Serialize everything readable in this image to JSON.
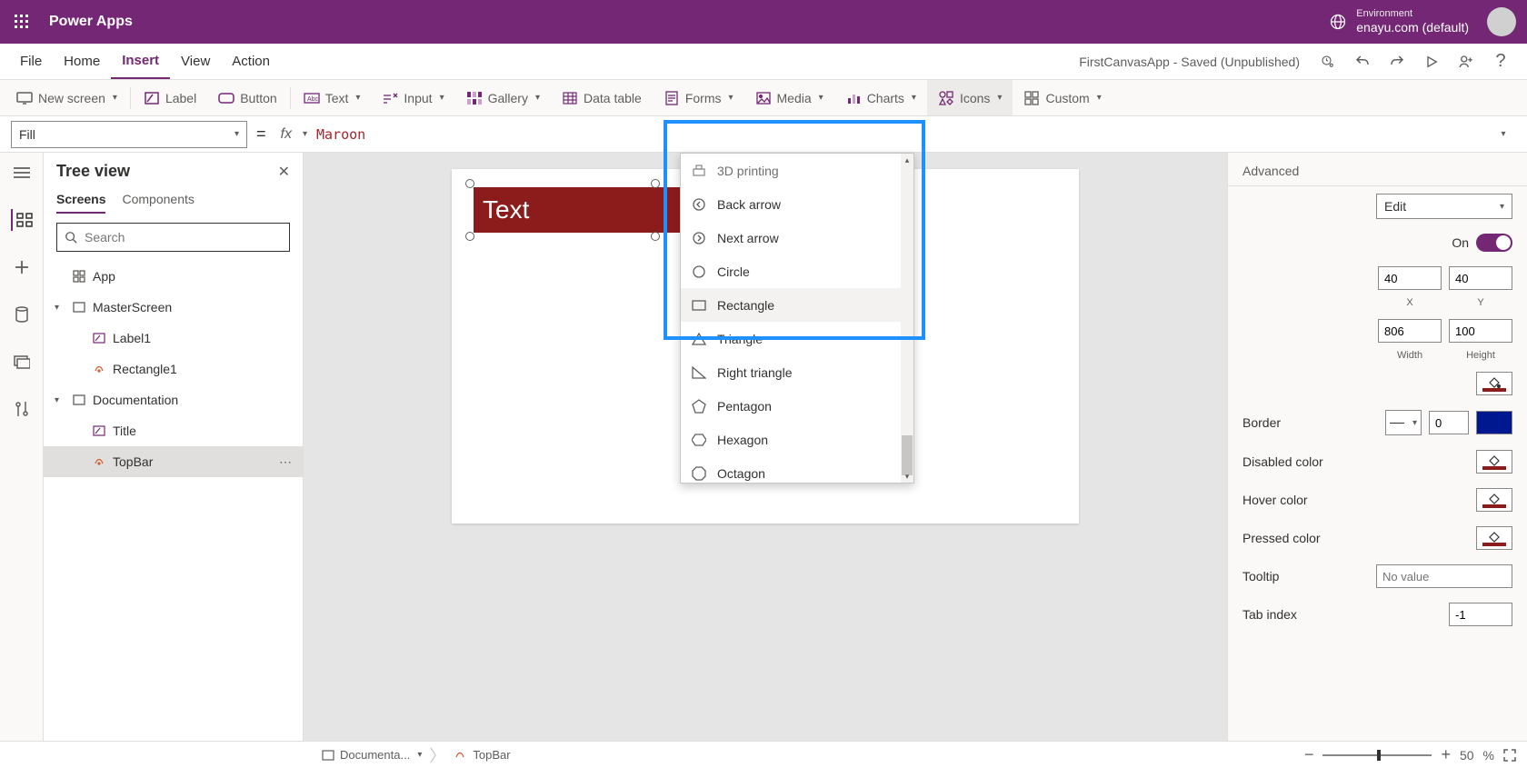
{
  "titlebar": {
    "app_name": "Power Apps",
    "env_label": "Environment",
    "env_value": "enayu.com (default)"
  },
  "menubar": {
    "items": [
      "File",
      "Home",
      "Insert",
      "View",
      "Action"
    ],
    "active_index": 2,
    "doc_status": "FirstCanvasApp - Saved (Unpublished)"
  },
  "ribbon": {
    "new_screen": "New screen",
    "label": "Label",
    "button": "Button",
    "text": "Text",
    "input": "Input",
    "gallery": "Gallery",
    "data_table": "Data table",
    "forms": "Forms",
    "media": "Media",
    "charts": "Charts",
    "icons": "Icons",
    "custom": "Custom"
  },
  "formula": {
    "property": "Fill",
    "value": "Maroon"
  },
  "tree": {
    "title": "Tree view",
    "tabs": [
      "Screens",
      "Components"
    ],
    "search_placeholder": "Search",
    "items": {
      "app": "App",
      "master": "MasterScreen",
      "label1": "Label1",
      "rect1": "Rectangle1",
      "doc": "Documentation",
      "title_item": "Title",
      "topbar": "TopBar"
    }
  },
  "canvas": {
    "selected_text": "Text"
  },
  "icons_menu": {
    "items": [
      "3D printing",
      "Back arrow",
      "Next arrow",
      "Circle",
      "Rectangle",
      "Triangle",
      "Right triangle",
      "Pentagon",
      "Hexagon",
      "Octagon"
    ],
    "hovered_index": 4
  },
  "properties": {
    "tabs": [
      "Advanced"
    ],
    "display_mode_label": "Edit",
    "on_label": "On",
    "pos_x": "40",
    "pos_y": "40",
    "size_w": "806",
    "size_h": "100",
    "x_label": "X",
    "y_label": "Y",
    "w_label": "Width",
    "h_label": "Height",
    "border_label": "Border",
    "border_val": "0",
    "disabled_color": "Disabled color",
    "hover_color": "Hover color",
    "pressed_color": "Pressed color",
    "tooltip_label": "Tooltip",
    "tooltip_placeholder": "No value",
    "tabindex_label": "Tab index",
    "tabindex_val": "-1"
  },
  "status": {
    "crumb1": "Documenta...",
    "crumb2": "TopBar",
    "zoom_val": "50",
    "zoom_pct": "%"
  }
}
